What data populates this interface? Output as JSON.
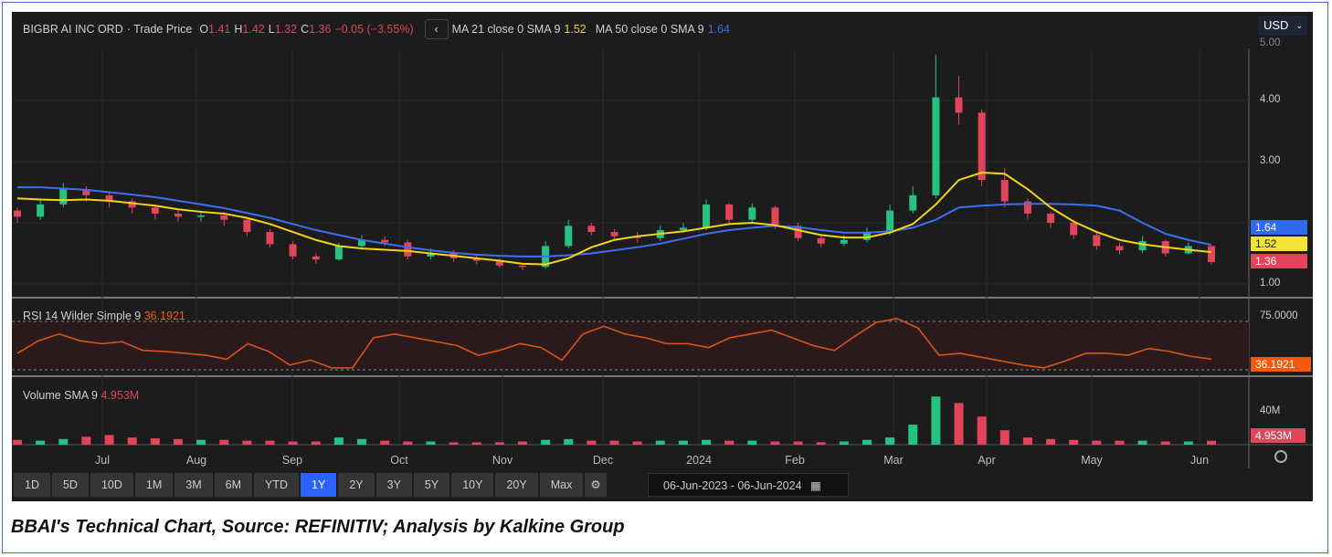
{
  "header": {
    "symbol": "BIGBR AI INC ORD",
    "price_type": "· Trade Price",
    "o_label": "O",
    "o": "1.41",
    "h_label": "H",
    "h": "1.42",
    "l_label": "L",
    "l": "1.32",
    "c_label": "C",
    "c": "1.36",
    "change": "−0.05 (−3.55%)",
    "ma21_label": "MA 21 close 0 SMA 9",
    "ma21_value": "1.52",
    "ma50_label": "MA 50 close 0 SMA 9",
    "ma50_value": "1.64",
    "currency": "USD"
  },
  "price_axis": {
    "ticks": [
      "5.00",
      "4.00",
      "3.00",
      "1.00"
    ],
    "tag_ma50": "1.64",
    "tag_ma21": "1.52",
    "tag_close": "1.36"
  },
  "rsi": {
    "label": "RSI 14 Wilder Simple 9",
    "value": "36.1921",
    "tick": "75.0000"
  },
  "volume": {
    "label": "Volume SMA 9",
    "value": "4.953M",
    "tick": "40M"
  },
  "x_labels": [
    "Jul",
    "Aug",
    "Sep",
    "Oct",
    "Nov",
    "Dec",
    "2024",
    "Feb",
    "Mar",
    "Apr",
    "May",
    "Jun"
  ],
  "toolbar": [
    "1D",
    "5D",
    "10D",
    "1M",
    "3M",
    "6M",
    "YTD",
    "1Y",
    "2Y",
    "3Y",
    "5Y",
    "10Y",
    "20Y",
    "Max"
  ],
  "active_range": "1Y",
  "date_from": "06-Jun-2023",
  "date_sep": "-",
  "date_to": "06-Jun-2024",
  "caption": "BBAI's Technical Chart, Source: REFINITIV; Analysis by Kalkine Group",
  "colors": {
    "up": "#26c281",
    "down": "#e0455a",
    "ma21": "#f1d519",
    "ma50": "#3e6ff0",
    "rsi": "#d9541a"
  },
  "chart_data": {
    "type": "candlestick",
    "title": "BIGBR AI INC ORD · Trade Price",
    "x_range": [
      "06-Jun-2023",
      "06-Jun-2024"
    ],
    "ylim": [
      0.79,
      4.87
    ],
    "close": [
      2.1,
      2.3,
      2.55,
      2.45,
      2.35,
      2.25,
      2.15,
      2.1,
      2.12,
      2.05,
      1.85,
      1.65,
      1.45,
      1.4,
      1.62,
      1.72,
      1.68,
      1.45,
      1.5,
      1.42,
      1.38,
      1.3,
      1.28,
      1.62,
      1.95,
      1.85,
      1.78,
      1.75,
      1.88,
      1.92,
      2.3,
      2.05,
      2.25,
      1.95,
      1.75,
      1.66,
      1.72,
      1.84,
      2.2,
      2.45,
      4.05,
      3.8,
      2.7,
      2.35,
      2.15,
      2.0,
      1.8,
      1.62,
      1.55,
      1.7,
      1.5,
      1.62,
      1.36
    ],
    "high": [
      2.25,
      2.4,
      2.65,
      2.6,
      2.5,
      2.4,
      2.3,
      2.22,
      2.2,
      2.18,
      2.08,
      1.9,
      1.7,
      1.5,
      1.68,
      1.8,
      1.78,
      1.72,
      1.58,
      1.55,
      1.48,
      1.42,
      1.35,
      1.7,
      2.05,
      2.0,
      1.9,
      1.85,
      1.95,
      2.0,
      2.38,
      2.32,
      2.32,
      2.28,
      2.0,
      1.8,
      1.8,
      1.92,
      2.3,
      2.6,
      4.75,
      4.4,
      3.85,
      2.9,
      2.4,
      2.18,
      2.05,
      1.85,
      1.68,
      1.78,
      1.72,
      1.68,
      1.42
    ],
    "low": [
      2.0,
      2.05,
      2.25,
      2.35,
      2.25,
      2.15,
      2.05,
      2.02,
      2.02,
      1.95,
      1.78,
      1.6,
      1.4,
      1.33,
      1.38,
      1.58,
      1.62,
      1.4,
      1.4,
      1.36,
      1.32,
      1.26,
      1.22,
      1.25,
      1.58,
      1.8,
      1.72,
      1.68,
      1.7,
      1.84,
      1.88,
      1.98,
      2.0,
      1.9,
      1.7,
      1.6,
      1.62,
      1.68,
      1.8,
      2.15,
      2.4,
      3.6,
      2.6,
      2.25,
      2.05,
      1.92,
      1.74,
      1.56,
      1.48,
      1.5,
      1.45,
      1.48,
      1.32
    ],
    "ma21": [
      2.4,
      2.38,
      2.37,
      2.38,
      2.36,
      2.32,
      2.28,
      2.22,
      2.18,
      2.15,
      2.08,
      1.98,
      1.85,
      1.72,
      1.62,
      1.58,
      1.56,
      1.54,
      1.5,
      1.46,
      1.42,
      1.38,
      1.33,
      1.32,
      1.42,
      1.6,
      1.72,
      1.78,
      1.82,
      1.86,
      1.92,
      1.98,
      2.0,
      1.96,
      1.88,
      1.8,
      1.76,
      1.76,
      1.84,
      1.98,
      2.3,
      2.7,
      2.82,
      2.8,
      2.55,
      2.25,
      2.02,
      1.85,
      1.72,
      1.65,
      1.6,
      1.56,
      1.52
    ],
    "ma50": [
      2.58,
      2.58,
      2.56,
      2.54,
      2.5,
      2.46,
      2.42,
      2.36,
      2.3,
      2.24,
      2.16,
      2.08,
      1.98,
      1.88,
      1.8,
      1.72,
      1.66,
      1.6,
      1.55,
      1.51,
      1.48,
      1.46,
      1.45,
      1.45,
      1.47,
      1.5,
      1.55,
      1.6,
      1.66,
      1.74,
      1.82,
      1.88,
      1.92,
      1.95,
      1.93,
      1.88,
      1.84,
      1.84,
      1.86,
      1.92,
      2.05,
      2.25,
      2.28,
      2.3,
      2.31,
      2.31,
      2.3,
      2.28,
      2.2,
      2.0,
      1.82,
      1.72,
      1.64
    ],
    "rsi": [
      42,
      55,
      62,
      55,
      52,
      54,
      45,
      44,
      42,
      40,
      36,
      52,
      44,
      30,
      35,
      27,
      27,
      58,
      62,
      58,
      54,
      50,
      40,
      45,
      52,
      48,
      35,
      62,
      70,
      62,
      58,
      52,
      52,
      48,
      58,
      62,
      66,
      58,
      50,
      45,
      60,
      74,
      78,
      68,
      40,
      42,
      38,
      34,
      30,
      27,
      34,
      42,
      42,
      40,
      47,
      44,
      39,
      36
    ],
    "rsi_ticks": [
      25,
      75
    ],
    "volume": [
      6,
      5,
      7,
      10,
      12,
      9,
      8,
      7,
      6,
      6,
      5,
      5,
      4,
      4,
      9,
      7,
      5,
      4,
      4,
      3,
      3,
      3,
      4,
      6,
      7,
      5,
      5,
      4,
      5,
      5,
      6,
      5,
      5,
      4,
      4,
      3,
      4,
      6,
      9,
      25,
      60,
      52,
      35,
      18,
      9,
      7,
      6,
      5,
      5,
      5,
      4,
      4,
      4.95
    ],
    "volume_unit": "M"
  }
}
